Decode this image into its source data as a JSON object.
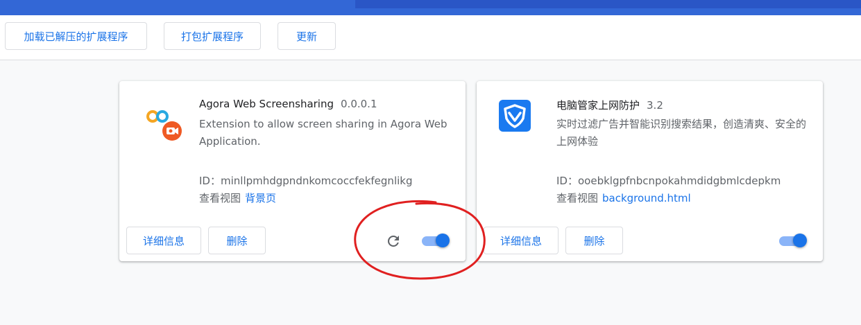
{
  "toolbar": {
    "load_unpacked": "加载已解压的扩展程序",
    "pack": "打包扩展程序",
    "update": "更新"
  },
  "extensions": [
    {
      "name": "Agora Web Screensharing",
      "version": "0.0.0.1",
      "description": "Extension to allow screen sharing in Agora Web Application.",
      "id_label": "ID：",
      "id": "minllpmhdgpndnkomcoccfekfegnlikg",
      "inspect_label": "查看视图",
      "inspect_link": "背景页",
      "details": "详细信息",
      "remove": "删除",
      "enabled": true,
      "icon": "agora-screensharing-icon"
    },
    {
      "name": "电脑管家上网防护",
      "version": "3.2",
      "description": "实时过滤广告并智能识别搜索结果，创造清爽、安全的上网体验",
      "id_label": "ID：",
      "id": "ooebklgpfnbcnpokahmdidgbmlcdepkm",
      "inspect_label": "查看视图",
      "inspect_link": "background.html",
      "details": "详细信息",
      "remove": "删除",
      "enabled": true,
      "icon": "shield-icon"
    }
  ],
  "colors": {
    "accent": "#1a73e8",
    "header": "#3367d6",
    "annotation": "#e02020"
  }
}
